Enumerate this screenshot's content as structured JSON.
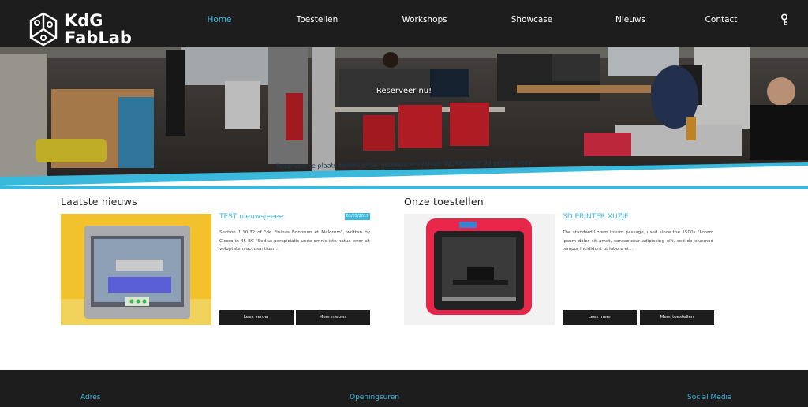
{
  "brand": {
    "line1": "KdG",
    "line2": "FabLab"
  },
  "nav": {
    "items": [
      {
        "label": "Home",
        "active": true
      },
      {
        "label": "Toestellen",
        "active": false
      },
      {
        "label": "Workshops",
        "active": false
      },
      {
        "label": "Showcase",
        "active": false
      },
      {
        "label": "Nieuws",
        "active": false
      },
      {
        "label": "Contact",
        "active": false
      }
    ],
    "user_icon": "user-key-icon"
  },
  "hero": {
    "cta": "Reserveer nu!",
    "banner": "Reserveer je plaats tijdens onze nieuwste workshop: WORKSHOP 3d printer yeey"
  },
  "news": {
    "section_title": "Laatste nieuws",
    "title": "TEST nieuwsjeeee",
    "date": "03/05/2019",
    "text": "Section 1.10.32 of \"de Finibus Bonorum et Malorum\", written by Cicero in 45 BC \"Sed ut perspiciatis unde omnis iste natus error sit voluptatem accusantium...",
    "read_more": "Lees verder",
    "more_news": "Meer nieuws"
  },
  "devices": {
    "section_title": "Onze toestellen",
    "title": "3D PRINTER XUZJF",
    "text": "The standard Lorem Ipsum passage, used since the 1500s \"Lorem ipsum dolor sit amet, consectetur adipiscing elit, sed do eiusmod tempor incididunt ut labore et...",
    "read_more": "Lees meer",
    "more_devices": "Meer toestellen"
  },
  "footer": {
    "address": "Adres",
    "hours": "Openingsuren",
    "social": "Social Media"
  },
  "colors": {
    "accent": "#3bb9dd",
    "dark": "#1d1d1d",
    "white": "#ffffff"
  }
}
